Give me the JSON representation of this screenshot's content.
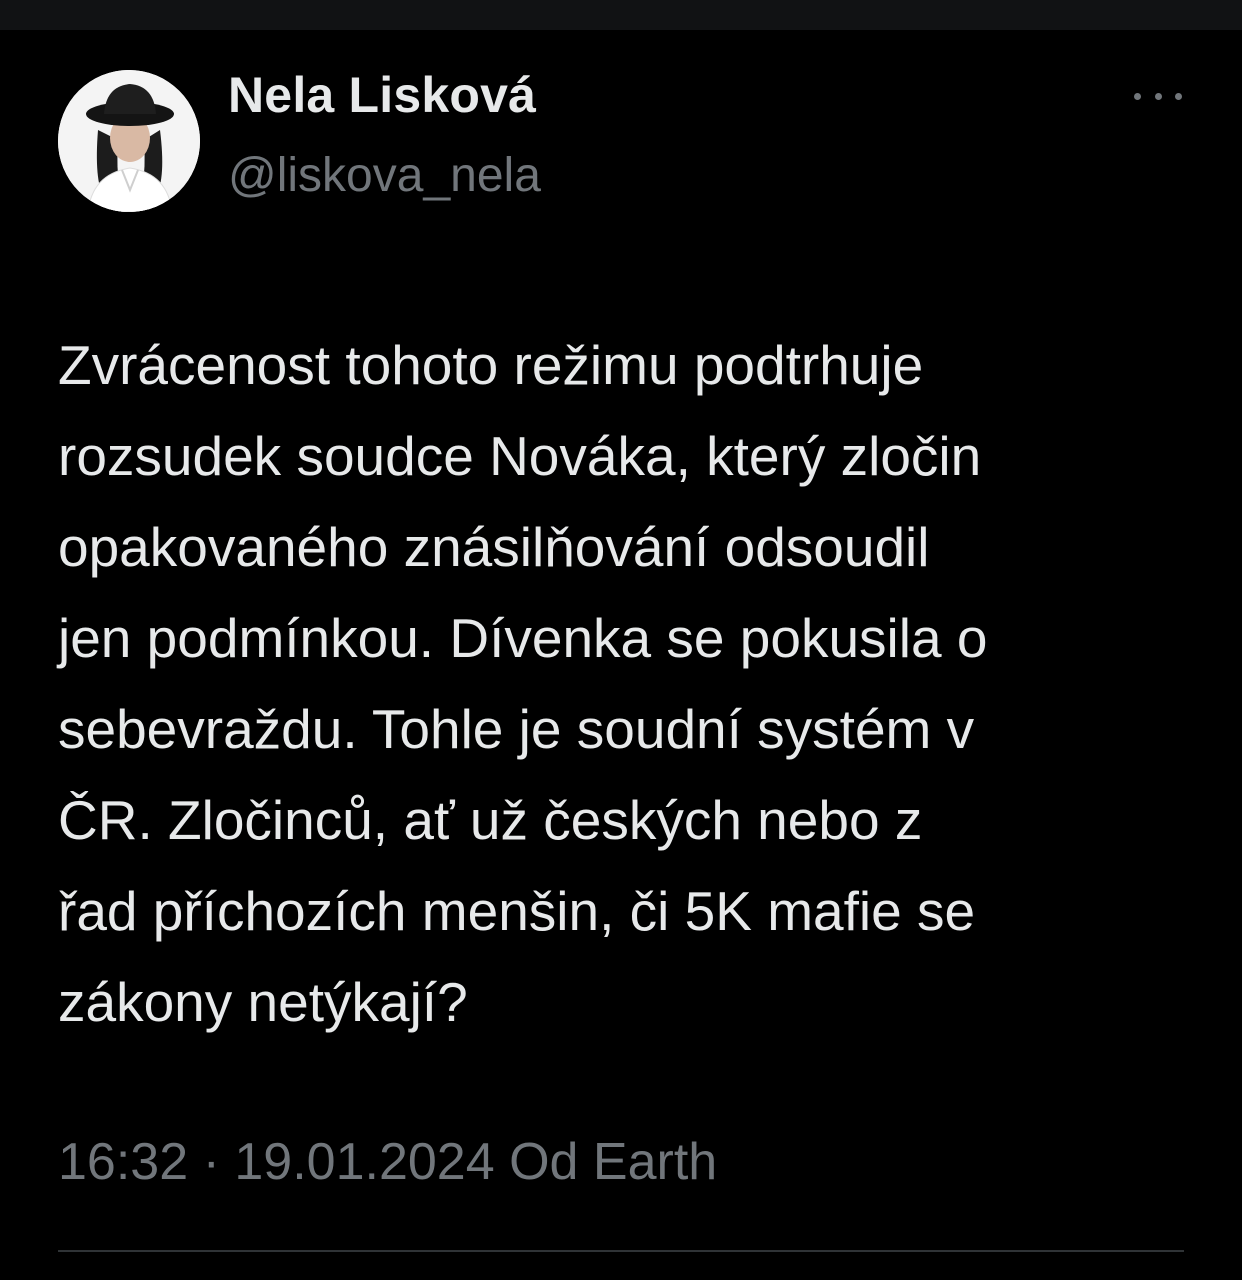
{
  "tweet": {
    "author": {
      "display_name": "Nela Lisková",
      "handle": "@liskova_nela",
      "avatar_icon": "profile-photo"
    },
    "more_icon": "ellipsis-icon",
    "text": "Zvrácenost tohoto režimu podtrhuje\nrozsudek soudce Nováka, který zločin\nopakovaného znásilňování odsoudil\njen podmínkou. Dívenka se pokusila o\nsebevraždu. Tohle je soudní systém v\nČR. Zločinců, ať už českých nebo z\nřad příchozích menšin, či 5K mafie se\nzákony netýkají?",
    "time": "16:32",
    "separator": "·",
    "date": "19.01.2024",
    "source": "Od Earth"
  },
  "colors": {
    "background": "#000000",
    "primary_text": "#e7e9ea",
    "secondary_text": "#71767b",
    "divider": "#2f3336"
  }
}
